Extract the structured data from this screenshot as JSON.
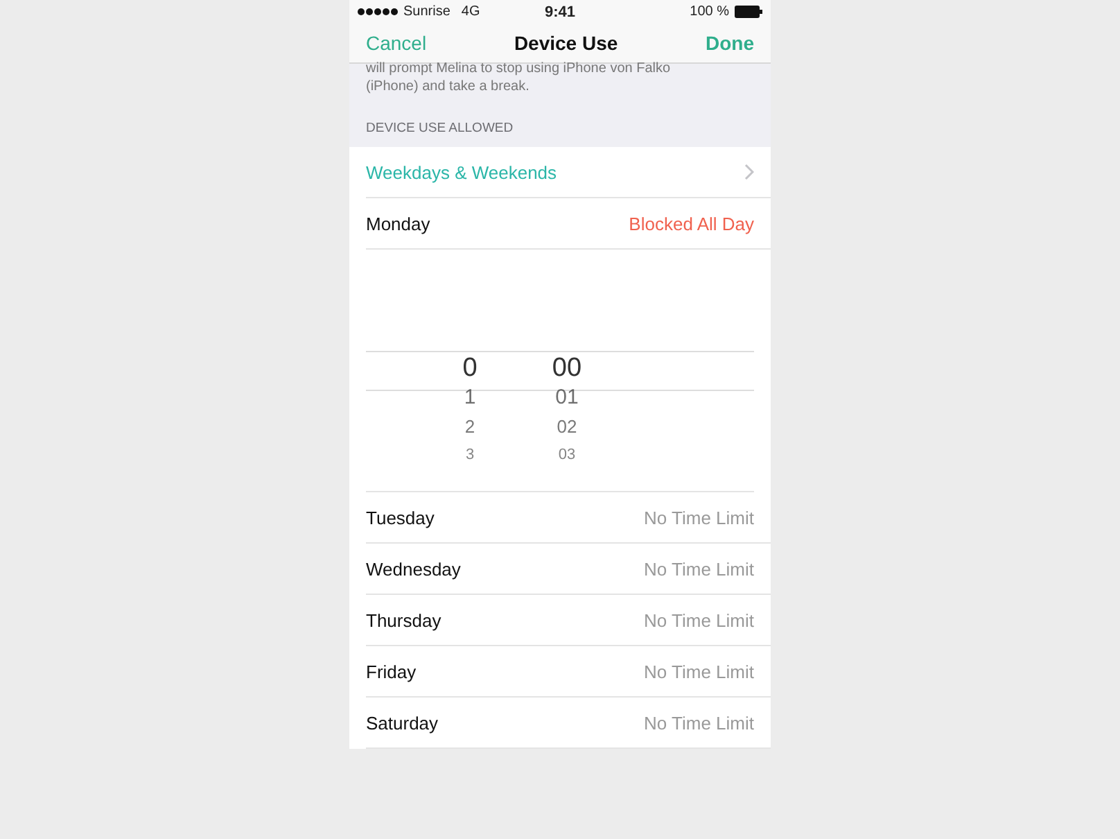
{
  "status_bar": {
    "carrier": "Sunrise",
    "network": "4G",
    "time": "9:41",
    "battery": "100 %"
  },
  "nav": {
    "left": "Cancel",
    "title": "Device Use",
    "right": "Done"
  },
  "description": "will prompt Melina to stop using iPhone von Falko (iPhone) and take a break.",
  "section_header": "DEVICE USE ALLOWED",
  "schedule": {
    "label": "Weekdays & Weekends"
  },
  "days": [
    {
      "day": "Monday",
      "value": "Blocked All Day",
      "kind": "blocked"
    }
  ],
  "picker": {
    "hours": [
      "0",
      "1",
      "2",
      "3"
    ],
    "minutes": [
      "00",
      "01",
      "02",
      "03"
    ]
  },
  "other_days": [
    {
      "day": "Tuesday",
      "value": "No Time Limit",
      "kind": "limit"
    },
    {
      "day": "Wednesday",
      "value": "No Time Limit",
      "kind": "limit"
    },
    {
      "day": "Thursday",
      "value": "No Time Limit",
      "kind": "limit"
    },
    {
      "day": "Friday",
      "value": "No Time Limit",
      "kind": "limit"
    },
    {
      "day": "Saturday",
      "value": "No Time Limit",
      "kind": "limit"
    }
  ]
}
